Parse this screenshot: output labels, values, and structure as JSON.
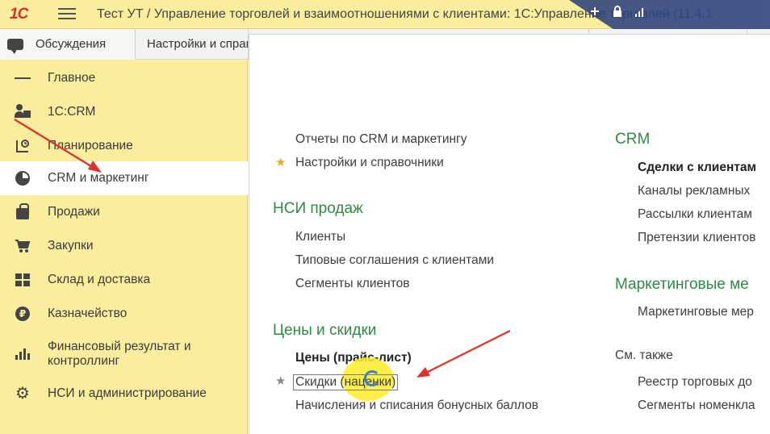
{
  "titlebar": {
    "logo": "1С",
    "title": "Тест УТ / Управление торговлей и взаимоотношениями с клиентами: 1С:Управление торговлей (11.4.1"
  },
  "tabs": [
    {
      "label": "Обсуждения",
      "icon": "chat-icon"
    },
    {
      "label": "Настройки и справочники"
    }
  ],
  "sidebar": {
    "items": [
      {
        "label": "Главное",
        "icon": "menu-icon"
      },
      {
        "label": "1С:CRM",
        "icon": "crm-user-icon"
      },
      {
        "label": "Планирование",
        "icon": "planning-icon"
      },
      {
        "label": "CRM и маркетинг",
        "icon": "pie-chart-icon",
        "active": true
      },
      {
        "label": "Продажи",
        "icon": "bag-icon"
      },
      {
        "label": "Закупки",
        "icon": "cart-icon"
      },
      {
        "label": "Склад и доставка",
        "icon": "warehouse-icon"
      },
      {
        "label": "Казначейство",
        "icon": "coin-icon"
      },
      {
        "label": "Финансовый результат и",
        "label2": "контроллинг",
        "icon": "bar-chart-icon"
      },
      {
        "label": "НСИ и администрирование",
        "icon": "gear-icon"
      }
    ]
  },
  "content": {
    "left": {
      "top_links": [
        "Отчеты по CRM и маркетингу",
        "Настройки и справочники"
      ],
      "nsi_heading": "НСИ продаж",
      "nsi_links": [
        "Клиенты",
        "Типовые соглашения с клиентами",
        "Сегменты клиентов"
      ],
      "prices_heading": "Цены и скидки",
      "prices_links": [
        "Цены (прайс-лист)",
        "Скидки (наценки)",
        "Начисления и списания бонусных баллов"
      ]
    },
    "right": {
      "crm_heading": "CRM",
      "crm_links": [
        "Сделки с клиентам",
        "Каналы рекламных",
        "Рассылки клиентам",
        "Претензии клиентов"
      ],
      "marketing_heading": "Маркетинговые ме",
      "marketing_links": [
        "Маркетинговые мер"
      ],
      "see_also": "См. также",
      "see_also_links": [
        "Реестр торговых до",
        "Сегменты номенкла"
      ]
    }
  },
  "colors": {
    "sidebar_bg": "#fbed9e",
    "heading_green": "#2f8a43",
    "arrow_red": "#e0322b",
    "favorite_star": "#f0a91b"
  }
}
